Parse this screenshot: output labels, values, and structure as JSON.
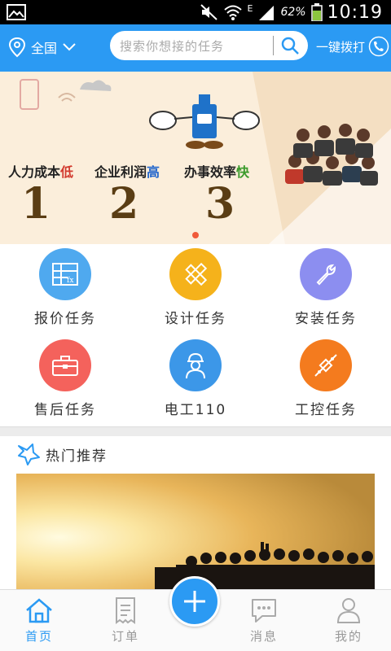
{
  "status_bar": {
    "battery_pct": "62%",
    "time": "10:19",
    "network": "E"
  },
  "top_bar": {
    "location": "全国",
    "search_placeholder": "搜索你想接的任务",
    "call_label": "一键拨打"
  },
  "banner": {
    "slogans": [
      {
        "prefix": "人力成本",
        "accent": "低",
        "number": "1"
      },
      {
        "prefix": "企业利润",
        "accent": "高",
        "number": "2"
      },
      {
        "prefix": "办事效率",
        "accent": "快",
        "number": "3"
      }
    ]
  },
  "categories": [
    {
      "label": "报价任务",
      "icon": "calculator-icon",
      "color": "#4fa9ef"
    },
    {
      "label": "设计任务",
      "icon": "pencil-ruler-icon",
      "color": "#f5b21b"
    },
    {
      "label": "安装任务",
      "icon": "wrench-icon",
      "color": "#8c8ef0"
    },
    {
      "label": "售后任务",
      "icon": "toolbox-icon",
      "color": "#f4625c"
    },
    {
      "label": "电工110",
      "icon": "electrician-icon",
      "color": "#3c97e8"
    },
    {
      "label": "工控任务",
      "icon": "circuit-icon",
      "color": "#f47b1e"
    }
  ],
  "hot": {
    "title": "热门推荐"
  },
  "bottom_nav": [
    {
      "label": "首页",
      "icon": "home-icon",
      "active": true
    },
    {
      "label": "订单",
      "icon": "receipt-icon",
      "active": false
    },
    {
      "label": "消息",
      "icon": "chat-icon",
      "active": false
    },
    {
      "label": "我的",
      "icon": "user-icon",
      "active": false
    }
  ],
  "colors": {
    "primary": "#2b9af3"
  }
}
